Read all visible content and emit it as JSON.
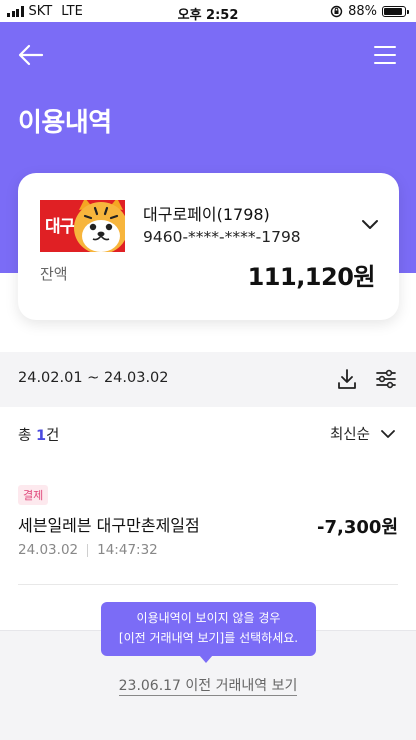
{
  "status_bar": {
    "carrier": "SKT",
    "network": "LTE",
    "time": "오후 2:52",
    "battery": "88%",
    "battery_level": 0.88
  },
  "header": {
    "title": "이용내역",
    "back_icon": "back-arrow-icon",
    "menu_icon": "hamburger-menu-icon",
    "background": "#7b6cf6"
  },
  "card": {
    "logo_text": "대구",
    "name": "대구로페이(1798)",
    "number": "9460-****-****-1798",
    "balance_label": "잔액",
    "balance": "111,120원",
    "logo_color": "#e02024"
  },
  "filter": {
    "date_range": "24.02.01 ~ 24.03.02",
    "download_icon": "download-icon",
    "filter_icon": "filter-sliders-icon"
  },
  "summary": {
    "total_prefix": "총 ",
    "total_count": "1",
    "total_suffix": "건",
    "sort_label": "최신순"
  },
  "transactions": [
    {
      "badge": "결제",
      "merchant": "세븐일레븐 대구만촌제일점",
      "amount": "-7,300원",
      "date": "24.03.02",
      "time": "14:47:32"
    }
  ],
  "tooltip": {
    "line1": "이용내역이 보이지 않을 경우",
    "line2": "[이전 거래내역 보기]를 선택하세요."
  },
  "history_link": "23.06.17 이전 거래내역 보기"
}
